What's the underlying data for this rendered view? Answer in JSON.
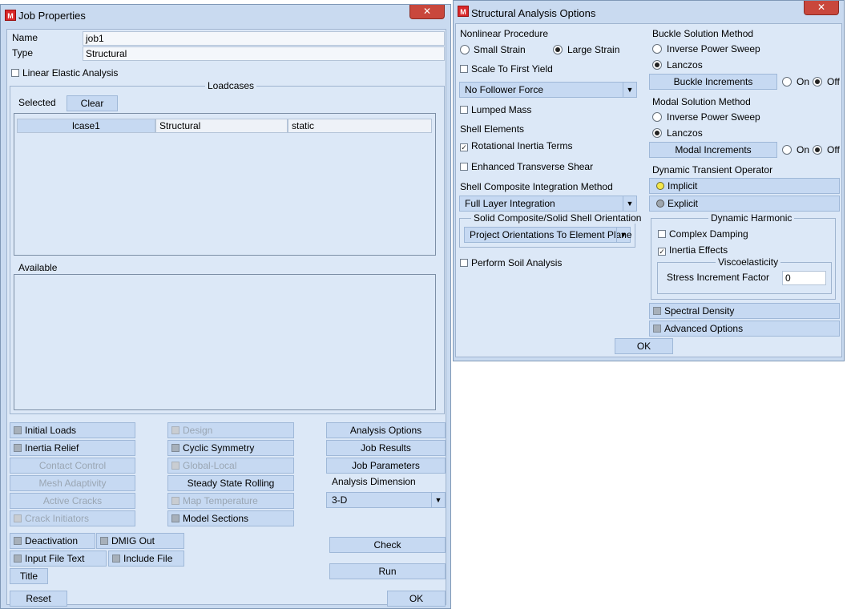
{
  "job": {
    "title": "Job Properties",
    "name_label": "Name",
    "name_value": "job1",
    "type_label": "Type",
    "type_value": "Structural",
    "linear_elastic": "Linear Elastic Analysis",
    "loadcases_group": "Loadcases",
    "selected_label": "Selected",
    "clear_button": "Clear",
    "selected_row": [
      "lcase1",
      "Structural",
      "static"
    ],
    "available_label": "Available",
    "buttons": {
      "initial_loads": "Initial Loads",
      "inertia_relief": "Inertia Relief",
      "contact_control": "Contact Control",
      "mesh_adaptivity": "Mesh Adaptivity",
      "active_cracks": "Active Cracks",
      "crack_initiators": "Crack Initiators",
      "design": "Design",
      "cyclic_symmetry": "Cyclic Symmetry",
      "global_local": "Global-Local",
      "steady_state_rolling": "Steady State Rolling",
      "map_temperature": "Map Temperature",
      "model_sections": "Model Sections",
      "analysis_options": "Analysis Options",
      "job_results": "Job Results",
      "job_parameters": "Job Parameters",
      "deactivation": "Deactivation",
      "dmig_out": "DMIG Out",
      "input_file_text": "Input File Text",
      "include_file": "Include File",
      "title": "Title",
      "check": "Check",
      "run": "Run",
      "reset": "Reset",
      "ok": "OK"
    },
    "analysis_dimension_label": "Analysis Dimension",
    "analysis_dimension_value": "3-D"
  },
  "sao": {
    "title": "Structural Analysis Options",
    "nonlinear_procedure": "Nonlinear Procedure",
    "small_strain": "Small Strain",
    "large_strain": "Large Strain",
    "scale_first_yield": "Scale To First Yield",
    "follower_force": "No Follower Force",
    "lumped_mass": "Lumped Mass",
    "shell_elements": "Shell Elements",
    "rotational_inertia": "Rotational Inertia Terms",
    "enhanced_shear": "Enhanced Transverse Shear",
    "shell_composite_method": "Shell Composite Integration Method",
    "full_layer": "Full Layer Integration",
    "solid_composite_group": "Solid Composite/Solid Shell Orientation",
    "project_orientations": "Project Orientations To Element Plane",
    "perform_soil": "Perform Soil Analysis",
    "buckle_method": "Buckle Solution Method",
    "inverse_power_sweep": "Inverse Power Sweep",
    "lanczos": "Lanczos",
    "buckle_increments": "Buckle Increments",
    "on": "On",
    "off": "Off",
    "modal_method": "Modal Solution Method",
    "modal_increments": "Modal Increments",
    "dynamic_transient": "Dynamic Transient Operator",
    "implicit": "Implicit",
    "explicit": "Explicit",
    "dynamic_harmonic": "Dynamic Harmonic",
    "complex_damping": "Complex Damping",
    "inertia_effects": "Inertia Effects",
    "viscoelasticity": "Viscoelasticity",
    "stress_increment_factor": "Stress Increment Factor",
    "stress_increment_value": "0",
    "spectral_density": "Spectral Density",
    "advanced_options": "Advanced Options",
    "ok": "OK"
  },
  "colors": {
    "window_bg": "#c9daf0",
    "panel_bg": "#dce8f7",
    "button_bg": "#c6d9f2",
    "close_red": "#c9473c",
    "logo_red": "#d8282a"
  }
}
